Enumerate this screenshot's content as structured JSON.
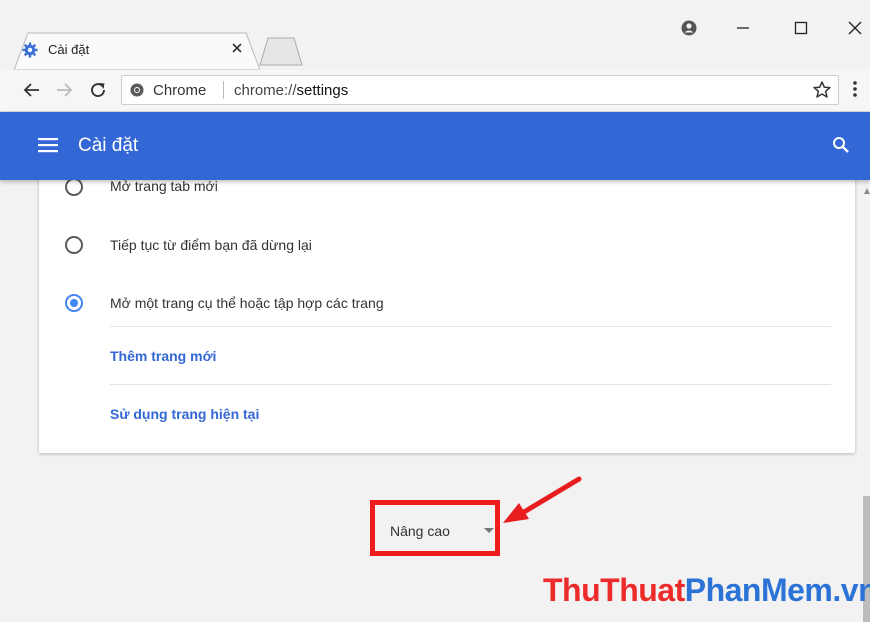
{
  "window": {
    "tab_title": "Cài đặt",
    "controls": {
      "minimize": "—",
      "maximize": "☐",
      "close": "✕"
    }
  },
  "toolbar": {
    "origin_chip": "Chrome",
    "url_scheme": "chrome://",
    "url_path": "settings"
  },
  "header": {
    "title": "Cài đặt"
  },
  "startup": {
    "options": [
      {
        "label": "Mở trang tab mới",
        "checked": false
      },
      {
        "label": "Tiếp tục từ điểm bạn đã dừng lại",
        "checked": false
      },
      {
        "label": "Mở một trang cụ thể hoặc tập hợp các trang",
        "checked": true
      }
    ],
    "add_page_link": "Thêm trang mới",
    "use_current_link": "Sử dụng trang hiện tại"
  },
  "advanced": {
    "label": "Nâng cao"
  },
  "watermark": {
    "part1": "ThuThuat",
    "part2": "PhanMem.vn"
  },
  "colors": {
    "header_blue": "#3367d6",
    "link_blue": "#3367d6",
    "radio_checked": "#4285f4",
    "highlight_red": "#ee1c1c"
  },
  "icons": [
    "settings-gear-icon",
    "tab-close-icon",
    "profile-icon",
    "back-arrow-icon",
    "forward-arrow-icon",
    "reload-icon",
    "chrome-logo-icon",
    "bookmark-star-icon",
    "menu-dots-icon",
    "hamburger-icon",
    "search-icon",
    "dropdown-caret-icon"
  ]
}
